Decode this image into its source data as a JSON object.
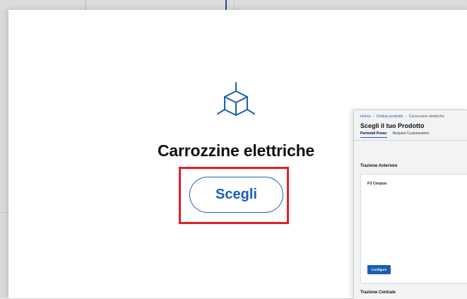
{
  "modal": {
    "icon": "cube-icon",
    "title": "Carrozzine elettriche",
    "choose_label": "Scegli"
  },
  "highlight_color": "#e21f26",
  "accent_color": "#1a5fb4",
  "preview": {
    "breadcrumb": {
      "home": "Home",
      "order": "Ordine prodotto",
      "current": "Carrozzine elettriche",
      "separator": "›"
    },
    "title": "Scegli il tuo Prodotto",
    "tabs": [
      "Permobil Power",
      "Request Customization"
    ],
    "sections": [
      {
        "title": "Trazione Anteriore",
        "card": {
          "name": "F3 Corpus",
          "button": "Configure"
        }
      },
      {
        "title": "Trazione Centrale"
      }
    ]
  }
}
